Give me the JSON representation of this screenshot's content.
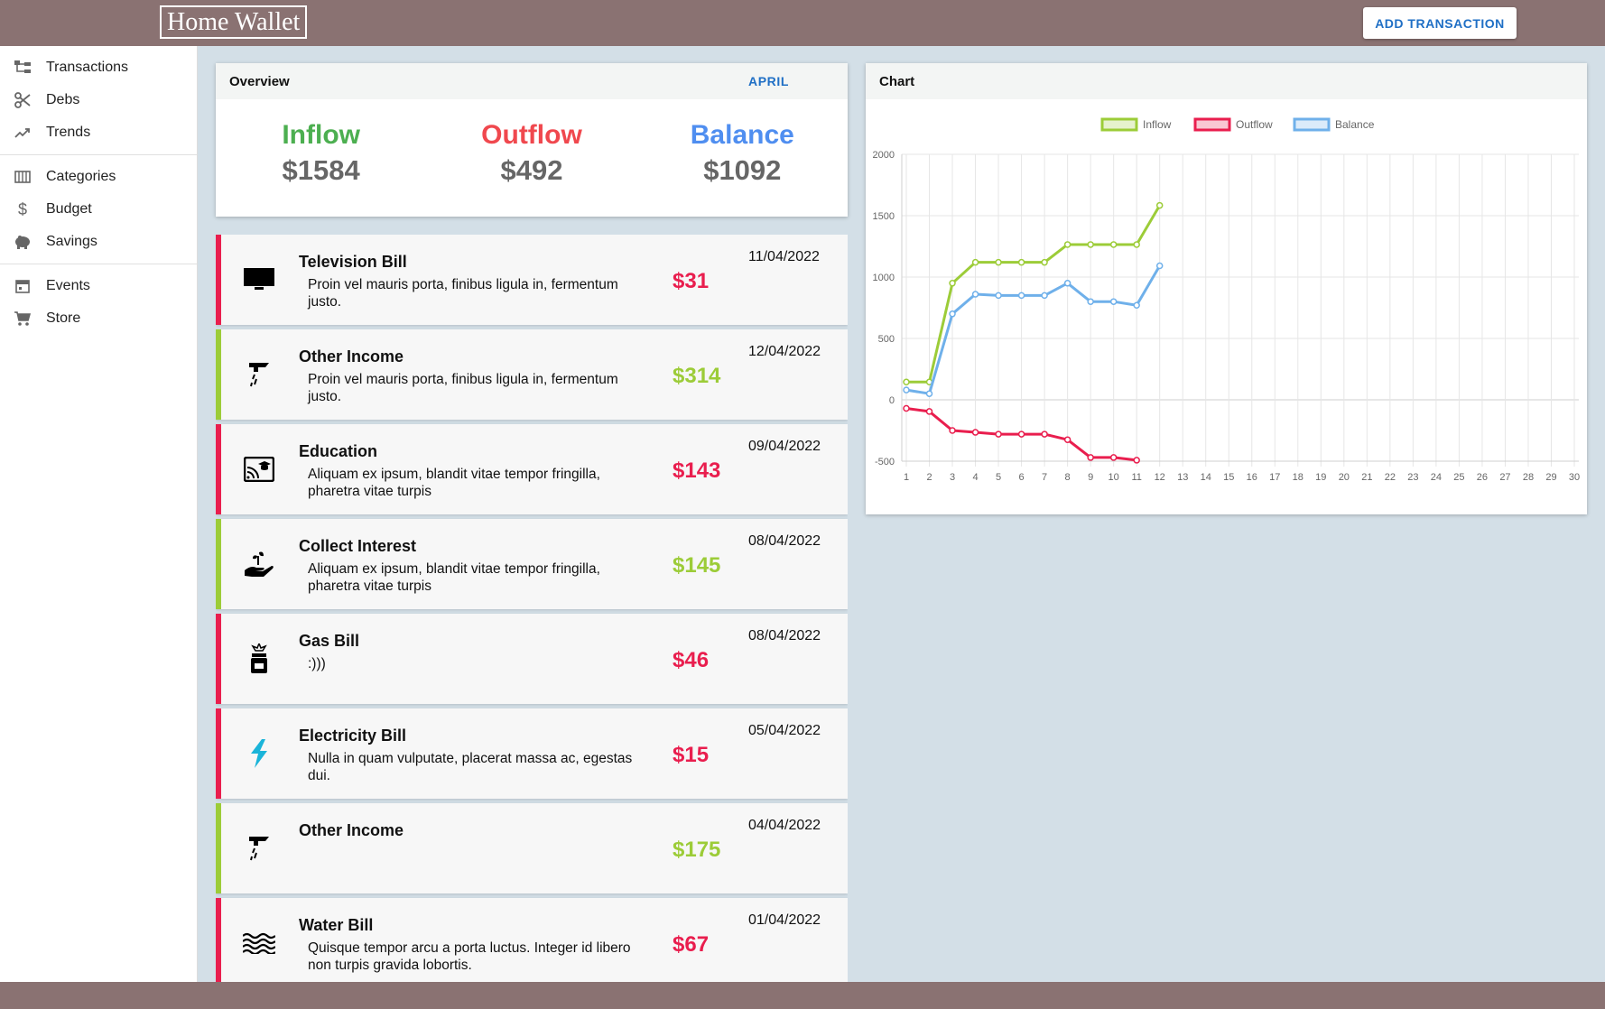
{
  "app": {
    "title": "Home Wallet",
    "add_button": "ADD TRANSACTION"
  },
  "sidebar": {
    "groups": [
      [
        {
          "label": "Transactions",
          "icon": "transactions-icon"
        },
        {
          "label": "Debs",
          "icon": "scissors-icon"
        },
        {
          "label": "Trends",
          "icon": "trending-up-icon"
        }
      ],
      [
        {
          "label": "Categories",
          "icon": "columns-icon"
        },
        {
          "label": "Budget",
          "icon": "dollar-icon"
        },
        {
          "label": "Savings",
          "icon": "piggy-bank-icon"
        }
      ],
      [
        {
          "label": "Events",
          "icon": "calendar-icon"
        },
        {
          "label": "Store",
          "icon": "cart-icon"
        }
      ]
    ]
  },
  "overview": {
    "title": "Overview",
    "month": "APRIL",
    "inflow": {
      "label": "Inflow",
      "value": "$1584",
      "color": "#4caf50"
    },
    "outflow": {
      "label": "Outflow",
      "value": "$492",
      "color": "#f0484e"
    },
    "balance": {
      "label": "Balance",
      "value": "$1092",
      "color": "#4f8ef0"
    }
  },
  "transactions": [
    {
      "title": "Television Bill",
      "desc": "Proin vel mauris porta, finibus ligula in, fermentum justo.",
      "amount": "$31",
      "date": "11/04/2022",
      "type": "out",
      "icon": "television-icon"
    },
    {
      "title": "Other Income",
      "desc": "Proin vel mauris porta, finibus ligula in, fermentum justo.",
      "amount": "$314",
      "date": "12/04/2022",
      "type": "in",
      "icon": "faucet-icon"
    },
    {
      "title": "Education",
      "desc": "Aliquam ex ipsum, blandit vitae tempor fringilla, pharetra vitae turpis",
      "amount": "$143",
      "date": "09/04/2022",
      "type": "out",
      "icon": "cast-education-icon"
    },
    {
      "title": "Collect Interest",
      "desc": "Aliquam ex ipsum, blandit vitae tempor fringilla, pharetra vitae turpis",
      "amount": "$145",
      "date": "08/04/2022",
      "type": "in",
      "icon": "hand-sprout-icon"
    },
    {
      "title": "Gas Bill",
      "desc": ":)))",
      "amount": "$46",
      "date": "08/04/2022",
      "type": "out",
      "icon": "gas-cylinder-icon"
    },
    {
      "title": "Electricity Bill",
      "desc": "Nulla in quam vulputate, placerat massa ac, egestas dui.",
      "amount": "$15",
      "date": "05/04/2022",
      "type": "out",
      "icon": "lightning-icon"
    },
    {
      "title": "Other Income",
      "desc": "",
      "amount": "$175",
      "date": "04/04/2022",
      "type": "in",
      "icon": "faucet-icon"
    },
    {
      "title": "Water Bill",
      "desc": "Quisque tempor arcu a porta luctus. Integer id libero non turpis gravida lobortis.",
      "amount": "$67",
      "date": "01/04/2022",
      "type": "out",
      "icon": "waves-icon"
    }
  ],
  "chart": {
    "title": "Chart"
  },
  "chart_data": {
    "type": "line",
    "x": [
      1,
      2,
      3,
      4,
      5,
      6,
      7,
      8,
      9,
      10,
      11,
      12,
      13,
      14,
      15,
      16,
      17,
      18,
      19,
      20,
      21,
      22,
      23,
      24,
      25,
      26,
      27,
      28,
      29,
      30
    ],
    "ylim": [
      -500,
      2000
    ],
    "yticks": [
      2000,
      1500,
      1000,
      500,
      0,
      -500
    ],
    "grid": true,
    "legend": "top-center",
    "series": [
      {
        "name": "Inflow",
        "color": "#9ccc38",
        "values": [
          145,
          145,
          950,
          1120,
          1120,
          1120,
          1120,
          1265,
          1265,
          1265,
          1265,
          1584
        ]
      },
      {
        "name": "Outflow",
        "color": "#e91e4e",
        "values": [
          -70,
          -95,
          -250,
          -265,
          -280,
          -280,
          -280,
          -325,
          -470,
          -470,
          -492
        ]
      },
      {
        "name": "Balance",
        "color": "#6fb0ea",
        "values": [
          80,
          50,
          700,
          860,
          850,
          850,
          850,
          950,
          800,
          800,
          770,
          1092
        ]
      }
    ]
  }
}
